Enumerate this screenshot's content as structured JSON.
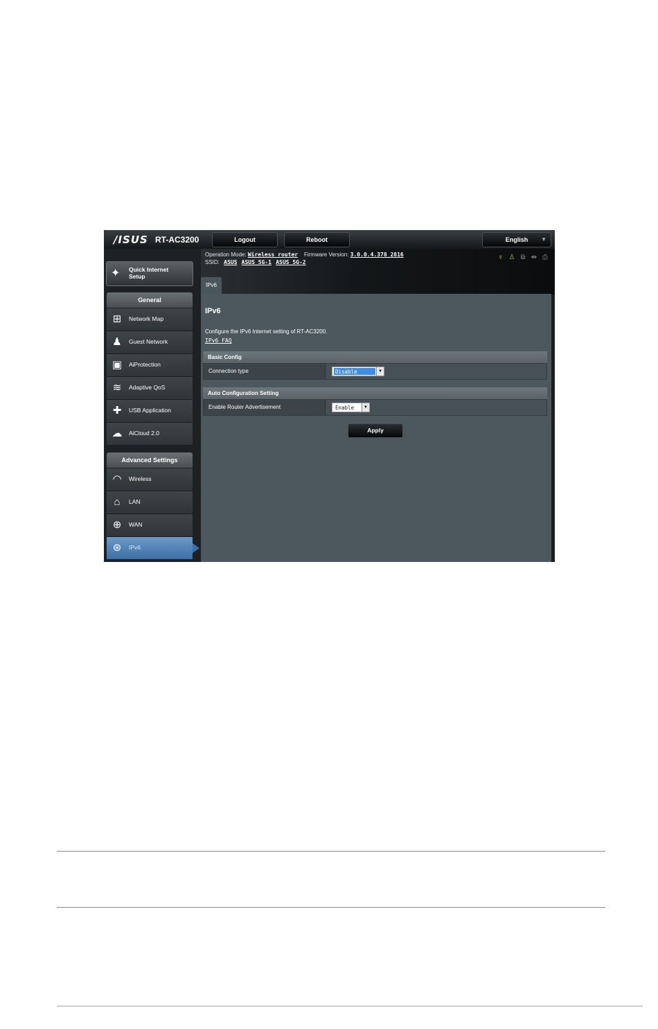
{
  "brand": {
    "logo": "/ISUS",
    "model": "RT-AC3200"
  },
  "topbar": {
    "logout": "Logout",
    "reboot": "Reboot",
    "language": "English"
  },
  "status": {
    "operation_mode_label": "Operation Mode:",
    "operation_mode": "Wireless router",
    "firmware_label": "Firmware Version:",
    "firmware": "3.0.0.4.378_2816",
    "ssid_label": "SSID:",
    "ssids": [
      "ASUS",
      "ASUS_5G-1",
      "ASUS_5G-2"
    ],
    "icons": [
      "lightbulb-icon",
      "user-icon",
      "copy-icon",
      "usb-icon",
      "printer-icon"
    ]
  },
  "sidebar": {
    "quick_setup": "Quick Internet Setup",
    "general_title": "General",
    "general_items": [
      {
        "label": "Network Map",
        "icon": "network-map-icon"
      },
      {
        "label": "Guest Network",
        "icon": "guest-network-icon"
      },
      {
        "label": "AiProtection",
        "icon": "lock-icon"
      },
      {
        "label": "Adaptive QoS",
        "icon": "qos-icon"
      },
      {
        "label": "USB Application",
        "icon": "puzzle-icon"
      },
      {
        "label": "AiCloud 2.0",
        "icon": "cloud-icon"
      }
    ],
    "advanced_title": "Advanced Settings",
    "advanced_items": [
      {
        "label": "Wireless",
        "icon": "wifi-icon"
      },
      {
        "label": "LAN",
        "icon": "house-icon"
      },
      {
        "label": "WAN",
        "icon": "globe-icon"
      },
      {
        "label": "IPv6",
        "icon": "ipv6-icon"
      }
    ]
  },
  "content": {
    "tab": "IPv6",
    "title": "IPv6",
    "description": "Configure the IPv6 Internet setting of RT-AC3200.",
    "faq_link": "IPv6 FAQ",
    "basic_config": {
      "header": "Basic Config",
      "connection_type_label": "Connection type",
      "connection_type_value": "Disable"
    },
    "auto_config": {
      "header": "Auto Configuration Setting",
      "router_adv_label": "Enable Router Advertisement",
      "router_adv_value": "Enable"
    },
    "apply": "Apply"
  },
  "colors": {
    "active_menu": "#3d6fa6",
    "panel": "#4d575e",
    "selected_option": "#3d8ee8"
  }
}
